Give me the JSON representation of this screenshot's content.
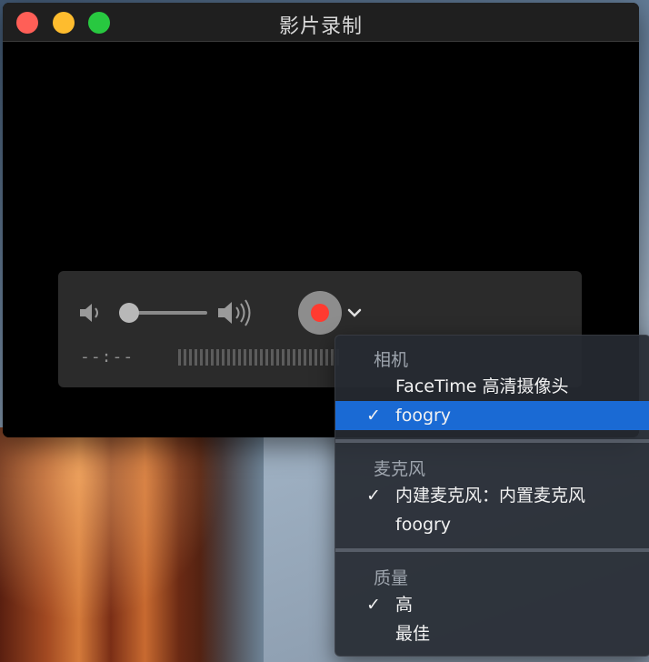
{
  "window": {
    "title": "影片录制"
  },
  "controls": {
    "time": "--:--"
  },
  "menu": {
    "sections": [
      {
        "header": "相机",
        "items": [
          {
            "label": "FaceTime 高清摄像头",
            "checked": false,
            "selected": false
          },
          {
            "label": "foogry",
            "checked": true,
            "selected": true
          }
        ]
      },
      {
        "header": "麦克风",
        "items": [
          {
            "label": "内建麦克风：内置麦克风",
            "checked": true,
            "selected": false
          },
          {
            "label": "foogry",
            "checked": false,
            "selected": false
          }
        ]
      },
      {
        "header": "质量",
        "items": [
          {
            "label": "高",
            "checked": true,
            "selected": false
          },
          {
            "label": "最佳",
            "checked": false,
            "selected": false
          }
        ]
      }
    ],
    "check_glyph": "✓"
  },
  "colors": {
    "record": "#ff3b30",
    "selection": "#1a6ad4"
  },
  "icons": {
    "volume_low": "speaker-low-icon",
    "volume_high": "speaker-high-icon",
    "record": "record-icon",
    "options": "chevron-down-icon"
  }
}
